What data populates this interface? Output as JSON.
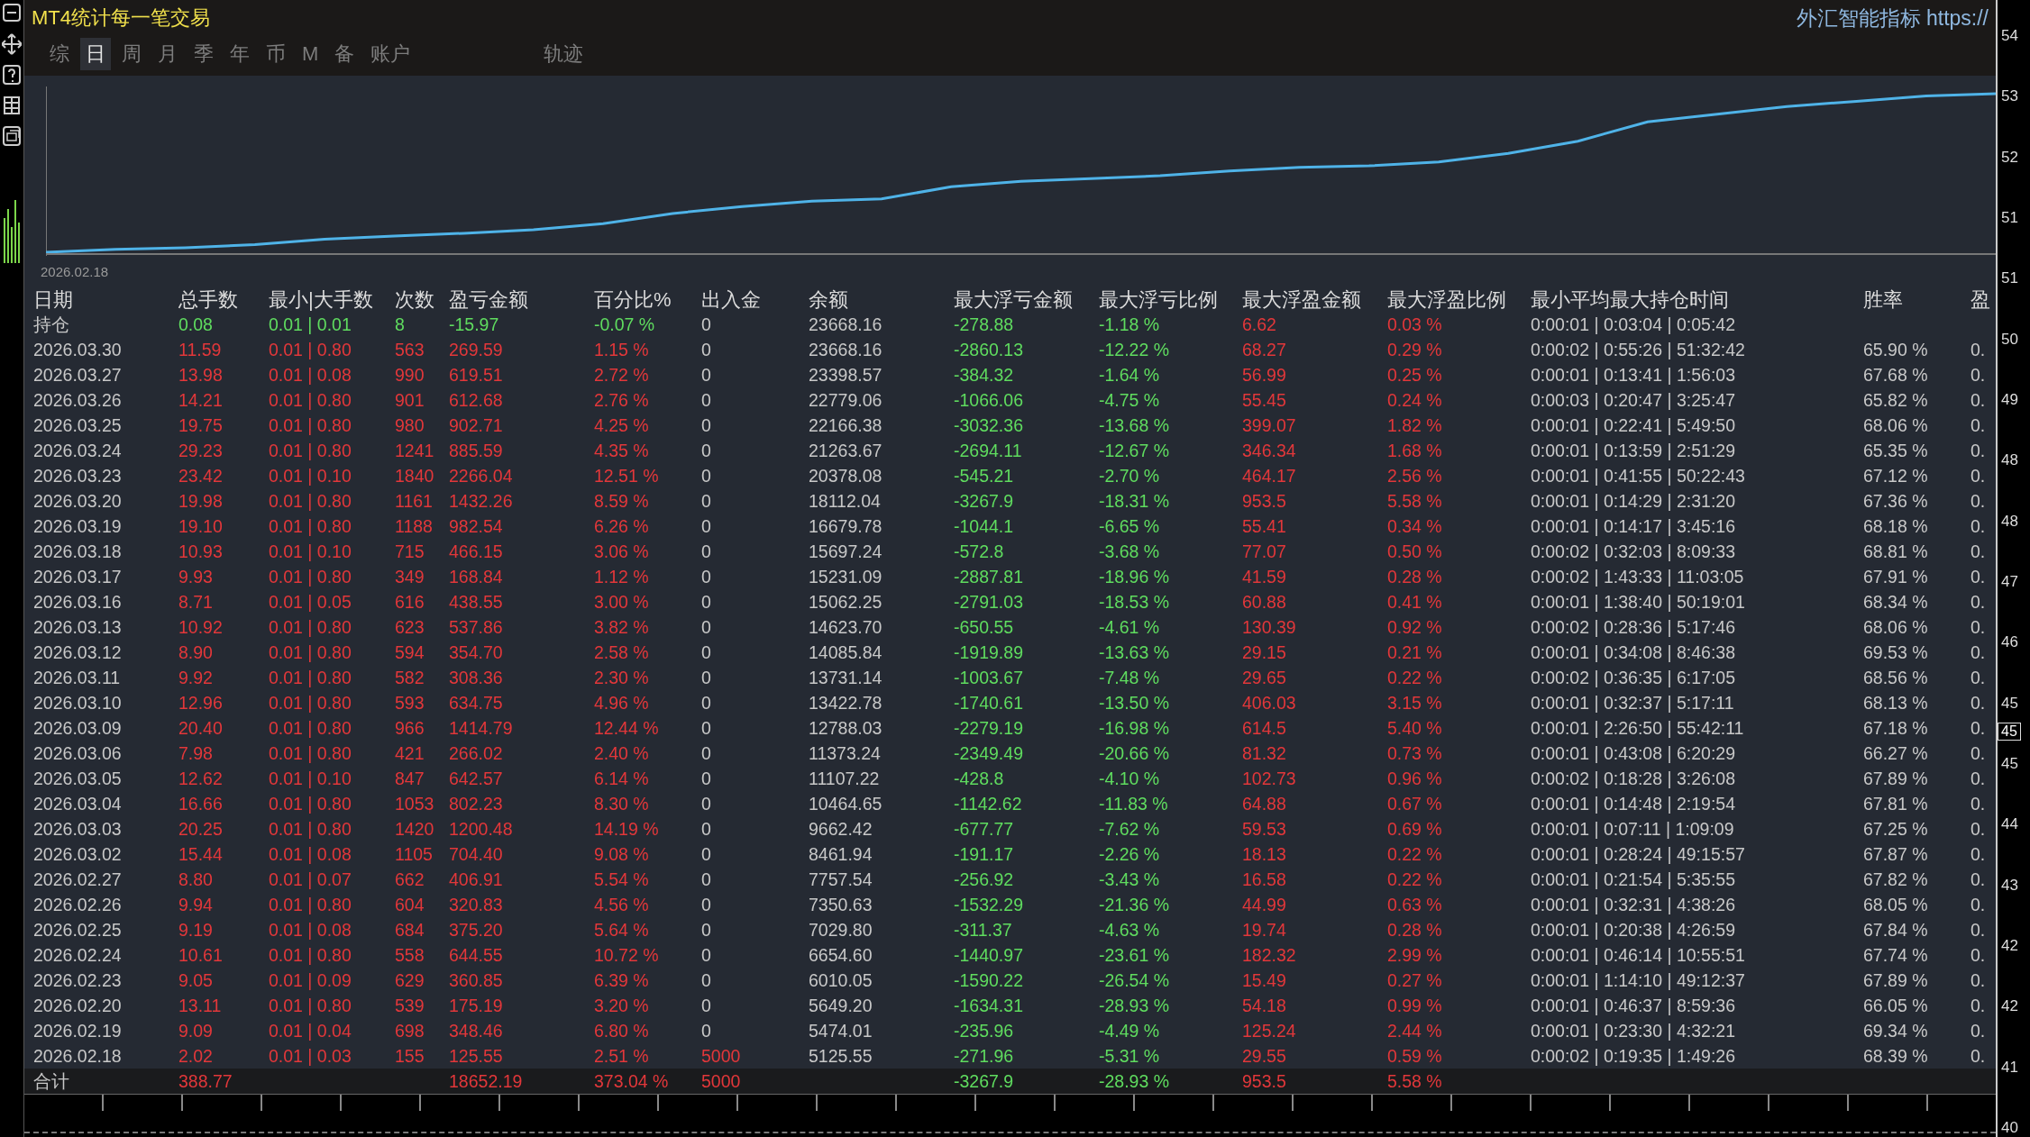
{
  "window": {
    "title": "MT4统计每一笔交易",
    "brand": "外汇智能指标 https://"
  },
  "tabs": [
    {
      "label": "综",
      "selected": false
    },
    {
      "label": "日",
      "selected": true
    },
    {
      "label": "周",
      "selected": false
    },
    {
      "label": "月",
      "selected": false
    },
    {
      "label": "季",
      "selected": false
    },
    {
      "label": "年",
      "selected": false
    },
    {
      "label": "币",
      "selected": false
    },
    {
      "label": "M",
      "selected": false
    },
    {
      "label": "备",
      "selected": false
    },
    {
      "label": "账户",
      "selected": false
    },
    {
      "label": "轨迹",
      "selected": false
    }
  ],
  "chart": {
    "start_label": "2026.02.18"
  },
  "table": {
    "columns": [
      "日期",
      "总手数",
      "最小|大手数",
      "次数",
      "盈亏金额",
      "百分比%",
      "出入金",
      "余额",
      "最大浮亏金额",
      "最大浮亏比例",
      "最大浮盈金额",
      "最大浮盈比例",
      "最小平均最大持仓时间",
      "胜率",
      "盈"
    ],
    "rows": [
      {
        "kind": "open",
        "deposit_colored": false,
        "date": "持仓",
        "lots": "0.08",
        "lot_range": "0.01 | 0.01",
        "trades": "8",
        "profit": "-15.97",
        "percent": "-0.07 %",
        "deposit": "0",
        "balance": "23668.16",
        "loss": "-278.88",
        "loss_pct": "-1.18 %",
        "gain": "6.62",
        "gain_pct": "0.03 %",
        "hold": "0:00:01 | 0:03:04 | 0:05:42"
      },
      {
        "kind": "day",
        "deposit_colored": false,
        "date": "2026.03.30",
        "lots": "11.59",
        "lot_range": "0.01 | 0.80",
        "trades": "563",
        "profit": "269.59",
        "percent": "1.15 %",
        "deposit": "0",
        "balance": "23668.16",
        "loss": "-2860.13",
        "loss_pct": "-12.22 %",
        "gain": "68.27",
        "gain_pct": "0.29 %",
        "hold": "0:00:02 | 0:55:26 | 51:32:42",
        "win": "65.90 %",
        "col15": "0."
      },
      {
        "kind": "day",
        "deposit_colored": false,
        "date": "2026.03.27",
        "lots": "13.98",
        "lot_range": "0.01 | 0.08",
        "trades": "990",
        "profit": "619.51",
        "percent": "2.72 %",
        "deposit": "0",
        "balance": "23398.57",
        "loss": "-384.32",
        "loss_pct": "-1.64 %",
        "gain": "56.99",
        "gain_pct": "0.25 %",
        "hold": "0:00:01 | 0:13:41 | 1:56:03",
        "win": "67.68 %",
        "col15": "0."
      },
      {
        "kind": "day",
        "deposit_colored": false,
        "date": "2026.03.26",
        "lots": "14.21",
        "lot_range": "0.01 | 0.80",
        "trades": "901",
        "profit": "612.68",
        "percent": "2.76 %",
        "deposit": "0",
        "balance": "22779.06",
        "loss": "-1066.06",
        "loss_pct": "-4.75 %",
        "gain": "55.45",
        "gain_pct": "0.24 %",
        "hold": "0:00:03 | 0:20:47 | 3:25:47",
        "win": "65.82 %",
        "col15": "0."
      },
      {
        "kind": "day",
        "deposit_colored": false,
        "date": "2026.03.25",
        "lots": "19.75",
        "lot_range": "0.01 | 0.80",
        "trades": "980",
        "profit": "902.71",
        "percent": "4.25 %",
        "deposit": "0",
        "balance": "22166.38",
        "loss": "-3032.36",
        "loss_pct": "-13.68 %",
        "gain": "399.07",
        "gain_pct": "1.82 %",
        "hold": "0:00:01 | 0:22:41 | 5:49:50",
        "win": "68.06 %",
        "col15": "0."
      },
      {
        "kind": "day",
        "deposit_colored": false,
        "date": "2026.03.24",
        "lots": "29.23",
        "lot_range": "0.01 | 0.80",
        "trades": "1241",
        "profit": "885.59",
        "percent": "4.35 %",
        "deposit": "0",
        "balance": "21263.67",
        "loss": "-2694.11",
        "loss_pct": "-12.67 %",
        "gain": "346.34",
        "gain_pct": "1.68 %",
        "hold": "0:00:01 | 0:13:59 | 2:51:29",
        "win": "65.35 %",
        "col15": "0."
      },
      {
        "kind": "day",
        "deposit_colored": false,
        "date": "2026.03.23",
        "lots": "23.42",
        "lot_range": "0.01 | 0.10",
        "trades": "1840",
        "profit": "2266.04",
        "percent": "12.51 %",
        "deposit": "0",
        "balance": "20378.08",
        "loss": "-545.21",
        "loss_pct": "-2.70 %",
        "gain": "464.17",
        "gain_pct": "2.56 %",
        "hold": "0:00:01 | 0:41:55 | 50:22:43",
        "win": "67.12 %",
        "col15": "0."
      },
      {
        "kind": "day",
        "deposit_colored": false,
        "date": "2026.03.20",
        "lots": "19.98",
        "lot_range": "0.01 | 0.80",
        "trades": "1161",
        "profit": "1432.26",
        "percent": "8.59 %",
        "deposit": "0",
        "balance": "18112.04",
        "loss": "-3267.9",
        "loss_pct": "-18.31 %",
        "gain": "953.5",
        "gain_pct": "5.58 %",
        "hold": "0:00:01 | 0:14:29 | 2:31:20",
        "win": "67.36 %",
        "col15": "0."
      },
      {
        "kind": "day",
        "deposit_colored": false,
        "date": "2026.03.19",
        "lots": "19.10",
        "lot_range": "0.01 | 0.80",
        "trades": "1188",
        "profit": "982.54",
        "percent": "6.26 %",
        "deposit": "0",
        "balance": "16679.78",
        "loss": "-1044.1",
        "loss_pct": "-6.65 %",
        "gain": "55.41",
        "gain_pct": "0.34 %",
        "hold": "0:00:01 | 0:14:17 | 3:45:16",
        "win": "68.18 %",
        "col15": "0."
      },
      {
        "kind": "day",
        "deposit_colored": false,
        "date": "2026.03.18",
        "lots": "10.93",
        "lot_range": "0.01 | 0.10",
        "trades": "715",
        "profit": "466.15",
        "percent": "3.06 %",
        "deposit": "0",
        "balance": "15697.24",
        "loss": "-572.8",
        "loss_pct": "-3.68 %",
        "gain": "77.07",
        "gain_pct": "0.50 %",
        "hold": "0:00:02 | 0:32:03 | 8:09:33",
        "win": "68.81 %",
        "col15": "0."
      },
      {
        "kind": "day",
        "deposit_colored": false,
        "date": "2026.03.17",
        "lots": "9.93",
        "lot_range": "0.01 | 0.80",
        "trades": "349",
        "profit": "168.84",
        "percent": "1.12 %",
        "deposit": "0",
        "balance": "15231.09",
        "loss": "-2887.81",
        "loss_pct": "-18.96 %",
        "gain": "41.59",
        "gain_pct": "0.28 %",
        "hold": "0:00:02 | 1:43:33 | 11:03:05",
        "win": "67.91 %",
        "col15": "0."
      },
      {
        "kind": "day",
        "deposit_colored": false,
        "date": "2026.03.16",
        "lots": "8.71",
        "lot_range": "0.01 | 0.05",
        "trades": "616",
        "profit": "438.55",
        "percent": "3.00 %",
        "deposit": "0",
        "balance": "15062.25",
        "loss": "-2791.03",
        "loss_pct": "-18.53 %",
        "gain": "60.88",
        "gain_pct": "0.41 %",
        "hold": "0:00:01 | 1:38:40 | 50:19:01",
        "win": "68.34 %",
        "col15": "0."
      },
      {
        "kind": "day",
        "deposit_colored": false,
        "date": "2026.03.13",
        "lots": "10.92",
        "lot_range": "0.01 | 0.80",
        "trades": "623",
        "profit": "537.86",
        "percent": "3.82 %",
        "deposit": "0",
        "balance": "14623.70",
        "loss": "-650.55",
        "loss_pct": "-4.61 %",
        "gain": "130.39",
        "gain_pct": "0.92 %",
        "hold": "0:00:02 | 0:28:36 | 5:17:46",
        "win": "68.06 %",
        "col15": "0."
      },
      {
        "kind": "day",
        "deposit_colored": false,
        "date": "2026.03.12",
        "lots": "8.90",
        "lot_range": "0.01 | 0.80",
        "trades": "594",
        "profit": "354.70",
        "percent": "2.58 %",
        "deposit": "0",
        "balance": "14085.84",
        "loss": "-1919.89",
        "loss_pct": "-13.63 %",
        "gain": "29.15",
        "gain_pct": "0.21 %",
        "hold": "0:00:01 | 0:34:08 | 8:46:38",
        "win": "69.53 %",
        "col15": "0."
      },
      {
        "kind": "day",
        "deposit_colored": false,
        "date": "2026.03.11",
        "lots": "9.92",
        "lot_range": "0.01 | 0.80",
        "trades": "582",
        "profit": "308.36",
        "percent": "2.30 %",
        "deposit": "0",
        "balance": "13731.14",
        "loss": "-1003.67",
        "loss_pct": "-7.48 %",
        "gain": "29.65",
        "gain_pct": "0.22 %",
        "hold": "0:00:02 | 0:36:35 | 6:17:05",
        "win": "68.56 %",
        "col15": "0."
      },
      {
        "kind": "day",
        "deposit_colored": false,
        "date": "2026.03.10",
        "lots": "12.96",
        "lot_range": "0.01 | 0.80",
        "trades": "593",
        "profit": "634.75",
        "percent": "4.96 %",
        "deposit": "0",
        "balance": "13422.78",
        "loss": "-1740.61",
        "loss_pct": "-13.50 %",
        "gain": "406.03",
        "gain_pct": "3.15 %",
        "hold": "0:00:01 | 0:32:37 | 5:17:11",
        "win": "68.13 %",
        "col15": "0."
      },
      {
        "kind": "day",
        "deposit_colored": false,
        "date": "2026.03.09",
        "lots": "20.40",
        "lot_range": "0.01 | 0.80",
        "trades": "966",
        "profit": "1414.79",
        "percent": "12.44 %",
        "deposit": "0",
        "balance": "12788.03",
        "loss": "-2279.19",
        "loss_pct": "-16.98 %",
        "gain": "614.5",
        "gain_pct": "5.40 %",
        "hold": "0:00:01 | 2:26:50 | 55:42:11",
        "win": "67.18 %",
        "col15": "0."
      },
      {
        "kind": "day",
        "deposit_colored": false,
        "date": "2026.03.06",
        "lots": "7.98",
        "lot_range": "0.01 | 0.80",
        "trades": "421",
        "profit": "266.02",
        "percent": "2.40 %",
        "deposit": "0",
        "balance": "11373.24",
        "loss": "-2349.49",
        "loss_pct": "-20.66 %",
        "gain": "81.32",
        "gain_pct": "0.73 %",
        "hold": "0:00:01 | 0:43:08 | 6:20:29",
        "win": "66.27 %",
        "col15": "0."
      },
      {
        "kind": "day",
        "deposit_colored": false,
        "date": "2026.03.05",
        "lots": "12.62",
        "lot_range": "0.01 | 0.10",
        "trades": "847",
        "profit": "642.57",
        "percent": "6.14 %",
        "deposit": "0",
        "balance": "11107.22",
        "loss": "-428.8",
        "loss_pct": "-4.10 %",
        "gain": "102.73",
        "gain_pct": "0.96 %",
        "hold": "0:00:02 | 0:18:28 | 3:26:08",
        "win": "67.89 %",
        "col15": "0."
      },
      {
        "kind": "day",
        "deposit_colored": false,
        "date": "2026.03.04",
        "lots": "16.66",
        "lot_range": "0.01 | 0.80",
        "trades": "1053",
        "profit": "802.23",
        "percent": "8.30 %",
        "deposit": "0",
        "balance": "10464.65",
        "loss": "-1142.62",
        "loss_pct": "-11.83 %",
        "gain": "64.88",
        "gain_pct": "0.67 %",
        "hold": "0:00:01 | 0:14:48 | 2:19:54",
        "win": "67.81 %",
        "col15": "0."
      },
      {
        "kind": "day",
        "deposit_colored": false,
        "date": "2026.03.03",
        "lots": "20.25",
        "lot_range": "0.01 | 0.80",
        "trades": "1420",
        "profit": "1200.48",
        "percent": "14.19 %",
        "deposit": "0",
        "balance": "9662.42",
        "loss": "-677.77",
        "loss_pct": "-7.62 %",
        "gain": "59.53",
        "gain_pct": "0.69 %",
        "hold": "0:00:01 | 0:07:11 | 1:09:09",
        "win": "67.25 %",
        "col15": "0."
      },
      {
        "kind": "day",
        "deposit_colored": false,
        "date": "2026.03.02",
        "lots": "15.44",
        "lot_range": "0.01 | 0.08",
        "trades": "1105",
        "profit": "704.40",
        "percent": "9.08 %",
        "deposit": "0",
        "balance": "8461.94",
        "loss": "-191.17",
        "loss_pct": "-2.26 %",
        "gain": "18.13",
        "gain_pct": "0.22 %",
        "hold": "0:00:01 | 0:28:24 | 49:15:57",
        "win": "67.87 %",
        "col15": "0."
      },
      {
        "kind": "day",
        "deposit_colored": false,
        "date": "2026.02.27",
        "lots": "8.80",
        "lot_range": "0.01 | 0.07",
        "trades": "662",
        "profit": "406.91",
        "percent": "5.54 %",
        "deposit": "0",
        "balance": "7757.54",
        "loss": "-256.92",
        "loss_pct": "-3.43 %",
        "gain": "16.58",
        "gain_pct": "0.22 %",
        "hold": "0:00:01 | 0:21:54 | 5:35:55",
        "win": "67.82 %",
        "col15": "0."
      },
      {
        "kind": "day",
        "deposit_colored": false,
        "date": "2026.02.26",
        "lots": "9.94",
        "lot_range": "0.01 | 0.80",
        "trades": "604",
        "profit": "320.83",
        "percent": "4.56 %",
        "deposit": "0",
        "balance": "7350.63",
        "loss": "-1532.29",
        "loss_pct": "-21.36 %",
        "gain": "44.99",
        "gain_pct": "0.63 %",
        "hold": "0:00:01 | 0:32:31 | 4:38:26",
        "win": "68.05 %",
        "col15": "0."
      },
      {
        "kind": "day",
        "deposit_colored": false,
        "date": "2026.02.25",
        "lots": "9.19",
        "lot_range": "0.01 | 0.08",
        "trades": "684",
        "profit": "375.20",
        "percent": "5.64 %",
        "deposit": "0",
        "balance": "7029.80",
        "loss": "-311.37",
        "loss_pct": "-4.63 %",
        "gain": "19.74",
        "gain_pct": "0.28 %",
        "hold": "0:00:01 | 0:20:38 | 4:26:59",
        "win": "67.84 %",
        "col15": "0."
      },
      {
        "kind": "day",
        "deposit_colored": false,
        "date": "2026.02.24",
        "lots": "10.61",
        "lot_range": "0.01 | 0.80",
        "trades": "558",
        "profit": "644.55",
        "percent": "10.72 %",
        "deposit": "0",
        "balance": "6654.60",
        "loss": "-1440.97",
        "loss_pct": "-23.61 %",
        "gain": "182.32",
        "gain_pct": "2.99 %",
        "hold": "0:00:01 | 0:46:14 | 10:55:51",
        "win": "67.74 %",
        "col15": "0."
      },
      {
        "kind": "day",
        "deposit_colored": false,
        "date": "2026.02.23",
        "lots": "9.05",
        "lot_range": "0.01 | 0.09",
        "trades": "629",
        "profit": "360.85",
        "percent": "6.39 %",
        "deposit": "0",
        "balance": "6010.05",
        "loss": "-1590.22",
        "loss_pct": "-26.54 %",
        "gain": "15.49",
        "gain_pct": "0.27 %",
        "hold": "0:00:01 | 1:14:10 | 49:12:37",
        "win": "67.89 %",
        "col15": "0."
      },
      {
        "kind": "day",
        "deposit_colored": false,
        "date": "2026.02.20",
        "lots": "13.11",
        "lot_range": "0.01 | 0.80",
        "trades": "539",
        "profit": "175.19",
        "percent": "3.20 %",
        "deposit": "0",
        "balance": "5649.20",
        "loss": "-1634.31",
        "loss_pct": "-28.93 %",
        "gain": "54.18",
        "gain_pct": "0.99 %",
        "hold": "0:00:01 | 0:46:37 | 8:59:36",
        "win": "66.05 %",
        "col15": "0."
      },
      {
        "kind": "day",
        "deposit_colored": false,
        "date": "2026.02.19",
        "lots": "9.09",
        "lot_range": "0.01 | 0.04",
        "trades": "698",
        "profit": "348.46",
        "percent": "6.80 %",
        "deposit": "0",
        "balance": "5474.01",
        "loss": "-235.96",
        "loss_pct": "-4.49 %",
        "gain": "125.24",
        "gain_pct": "2.44 %",
        "hold": "0:00:01 | 0:23:30 | 4:32:21",
        "win": "69.34 %",
        "col15": "0."
      },
      {
        "kind": "day",
        "deposit_colored": true,
        "date": "2026.02.18",
        "lots": "2.02",
        "lot_range": "0.01 | 0.03",
        "trades": "155",
        "profit": "125.55",
        "percent": "2.51 %",
        "deposit": "5000",
        "balance": "5125.55",
        "loss": "-271.96",
        "loss_pct": "-5.31 %",
        "gain": "29.55",
        "gain_pct": "0.59 %",
        "hold": "0:00:02 | 0:19:35 | 1:49:26",
        "win": "68.39 %",
        "col15": "0."
      },
      {
        "kind": "total",
        "deposit_colored": true,
        "date": "合计",
        "lots": "388.77",
        "profit": "18652.19",
        "percent": "373.04 %",
        "deposit": "5000",
        "loss": "-3267.9",
        "loss_pct": "-28.93 %",
        "gain": "953.5",
        "gain_pct": "5.58 %"
      }
    ]
  },
  "price_axis": {
    "ticks": [
      "54",
      "53",
      "52",
      "51",
      "51",
      "50",
      "49",
      "48",
      "48",
      "47",
      "46",
      "45",
      "45",
      "44",
      "43",
      "42",
      "42",
      "41",
      "40"
    ],
    "current": "45"
  }
}
